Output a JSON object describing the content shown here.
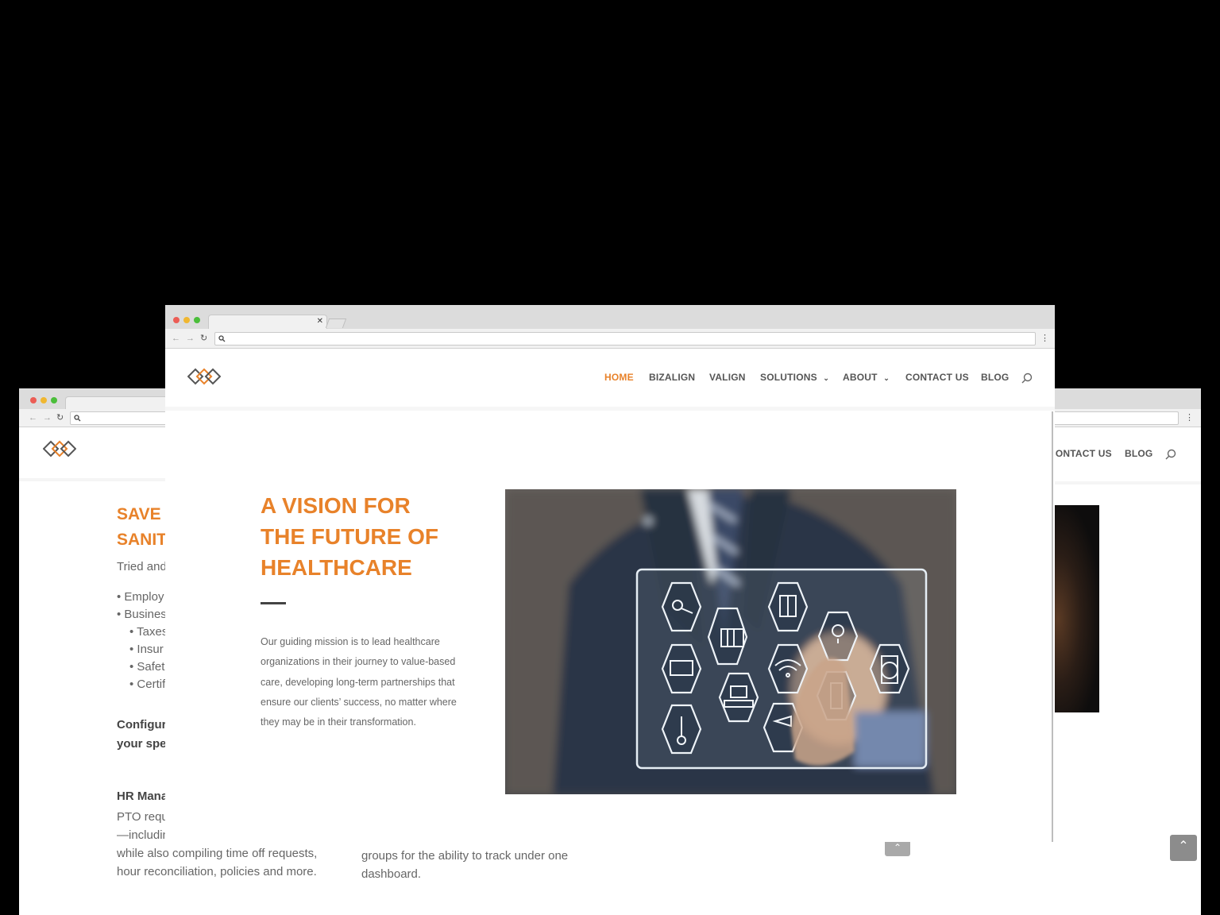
{
  "colors": {
    "accent": "#e8822a",
    "nav_text": "#555555",
    "body_text": "#666666",
    "backdrop": "#000000"
  },
  "left_window": {
    "heading_lines": [
      "SAVE ",
      "SANIT"
    ],
    "intro": "Tried and",
    "bullets": [
      "Employ",
      "Busines"
    ],
    "sub_bullets": [
      "Taxes",
      "Insur",
      "Safet",
      "Certif"
    ],
    "config_lines": [
      "Configur",
      "your spe"
    ],
    "hr_title": "HR Mana",
    "hr_lines": [
      "PTO requ",
      "—includin",
      "while also compiling time off requests,",
      "hour reconciliation, policies and more."
    ],
    "col2_lines": [
      "groups for the ability to track under one",
      "dashboard."
    ]
  },
  "right_window": {
    "menu": [
      "CONTACT US",
      "BLOG"
    ]
  },
  "main_window": {
    "menu": {
      "home": "HOME",
      "bizalign": "BIZALIGN",
      "valign": "VALIGN",
      "solutions": "SOLUTIONS",
      "about": "ABOUT",
      "contact": "CONTACT US",
      "blog": "BLOG"
    },
    "hero": {
      "title_lines": [
        "A VISION FOR",
        "THE FUTURE OF",
        "HEALTHCARE"
      ],
      "body_lines": [
        "Our guiding mission is to lead healthcare",
        "organizations in their journey to value-based",
        "care, developing long-term partnerships that",
        "ensure our clients’ success, no matter where",
        "they may be in their transformation."
      ]
    },
    "icons": {
      "search": "search-icon",
      "chevron": "chevron-down-icon",
      "scroll_top": "chevron-up-icon"
    }
  }
}
